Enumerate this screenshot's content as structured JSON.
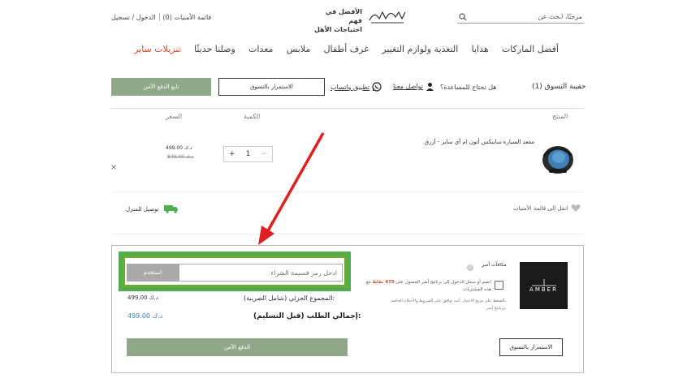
{
  "header": {
    "search_placeholder": "مرحبًا، ابحث عن",
    "tagline_line1": "الأفضل في فهم",
    "tagline_line2": "احتياجات الأهل",
    "login_register": "الدخول / تسجيل",
    "wishlist_link": "قائمة الأمنيات (0)"
  },
  "nav": {
    "items": [
      "تنزيلات ساير",
      "وصلنا حديثًا",
      "معدات",
      "ملابس",
      "غرف أطفال",
      "التغذية ولوازم التغيير",
      "هدايا",
      "أفضل الماركات"
    ]
  },
  "cart": {
    "title": "حقيبة التسوق (1)",
    "help": "هل تحتاج للمساعدة؟",
    "contact": "تواصل معنا",
    "whatsapp": "تطبيق واتساب",
    "continue_shopping": "الاستمرار بالتسوق",
    "checkout_secure": "تابع الدفع الآمن",
    "col_product": "المنتج",
    "col_qty": "الكمية",
    "col_price": "السعر"
  },
  "product": {
    "name": "مقعد السيارة سايبكس أتون ام آي سايز - أزرق",
    "qty": "1",
    "price_now": "499.00 د.ك",
    "price_old": "849.00 د.ك",
    "move_to_wishlist": "انقل إلى قائمة الأمنيات",
    "delivery": "توصيل للمنزل"
  },
  "summary": {
    "promo_placeholder": "ادخل رمز قسيمة الشراء",
    "promo_apply": "استخدم",
    "subtotal_label": "المجموع الجزئي (شامل الضريبة):",
    "subtotal_value": "499.00 د.ك",
    "total_label": "إجمالي الطلب (قبل التسليم):",
    "total_value": "499.00 د.ك",
    "checkout_secure": "الدفع الآمن",
    "continue_shopping": "الاستمرار بالتسوق"
  },
  "amber": {
    "title": "مكافآت أمبر",
    "logo_text": "AMBER",
    "offer_prefix": "انضم أو سجل الدخول إلى برنامج أمبر الحصول على",
    "points": "475 نقاط",
    "offer_suffix": "مع هذه المشتريات",
    "note": "بالضغط على مربع الاختيار، أنت توافق على الشروط والأحكام الخاصة ببرنامج أمبر"
  },
  "colors": {
    "accent_green": "#8fa88a",
    "sale_red": "#d84b2a",
    "highlight_green": "#4cae4c",
    "arrow_red": "#e02020"
  }
}
